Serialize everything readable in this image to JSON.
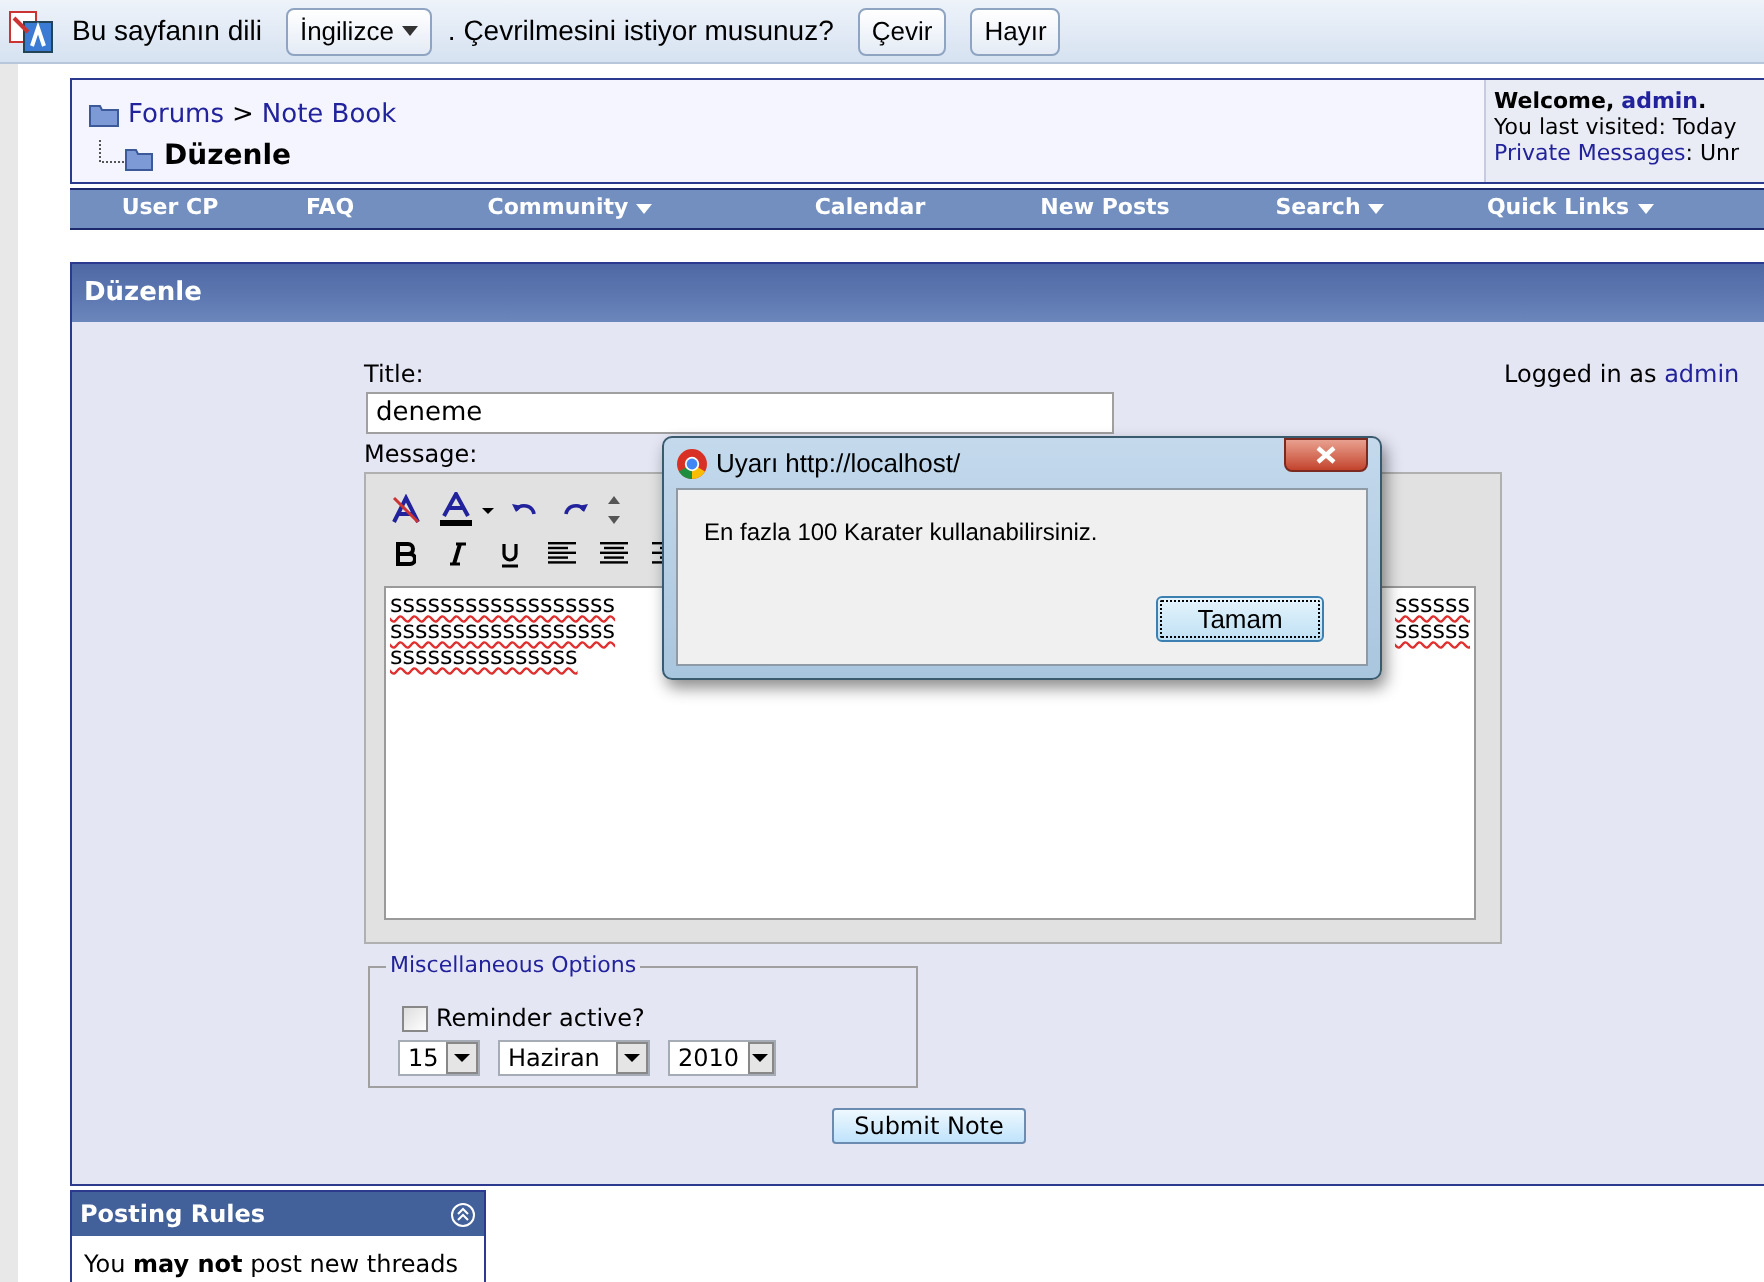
{
  "translate_bar": {
    "prefix": "Bu sayfanın dili",
    "language": "İngilizce",
    "question": ". Çevrilmesini istiyor musunuz?",
    "buttons": [
      "Çevir",
      "Hayır"
    ]
  },
  "breadcrumb": {
    "items": [
      "Forums",
      "Note Book"
    ],
    "separator": ">",
    "current": "Düzenle"
  },
  "welcome": {
    "greeting": "Welcome,",
    "user": "admin",
    "dot": ".",
    "last_visited": "You last visited: Today",
    "pm_link": "Private Messages",
    "pm_rest": ": Unr"
  },
  "nav": [
    {
      "label": "User CP",
      "has_menu": false
    },
    {
      "label": "FAQ",
      "has_menu": false
    },
    {
      "label": "Community",
      "has_menu": true
    },
    {
      "label": "Calendar",
      "has_menu": false
    },
    {
      "label": "New Posts",
      "has_menu": false
    },
    {
      "label": "Search",
      "has_menu": true
    },
    {
      "label": "Quick Links",
      "has_menu": true
    }
  ],
  "panel": {
    "title": "Düzenle",
    "logged_in": "Logged in as",
    "logged_user": "admin",
    "title_label": "Title:",
    "title_value": "deneme",
    "message_label": "Message:",
    "message_lines": [
      {
        "left": "ssssssssssssssssss",
        "right": "ssssss"
      },
      {
        "left": "ssssssssssssssssss",
        "right": "ssssss"
      },
      {
        "left": "sssssssssssssss"
      }
    ],
    "options": {
      "legend": "Miscellaneous Options",
      "reminder": {
        "label": "Reminder active?",
        "checked": false
      },
      "day": "15",
      "month": "Haziran",
      "year": "2010"
    },
    "submit": "Submit Note"
  },
  "posting_rules": {
    "title": "Posting Rules",
    "text": "You **may not** post new threads"
  },
  "dialog": {
    "title": "Uyarı http://localhost/",
    "message": "En fazla 100 Karater kullanabilirsiniz.",
    "button": "Tamam"
  }
}
